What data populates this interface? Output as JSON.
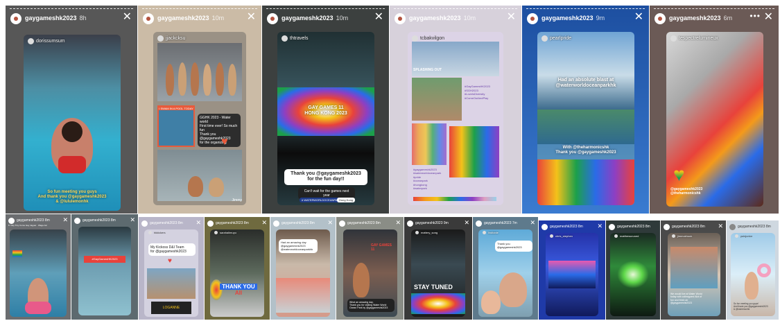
{
  "stories_top": [
    {
      "user": "gaygameshk2023",
      "time": "8h",
      "colors": {
        "bg": "#5b5b5b",
        "accent": "#33b8d4"
      },
      "inner_user": "dorissumsum",
      "caption": [
        "So fun meeting you guys",
        "And thank you @gaygameshk2023",
        "& @lululemonhk"
      ]
    },
    {
      "user": "gaygameshk2023",
      "time": "10m",
      "colors": {
        "bg": "#c9b8a2",
        "accent": "#e85a3b"
      },
      "inner_user": "jjackcksu",
      "sign_text": "I SWAM IN A POOL TODAY",
      "note": [
        "GGHK 2023 - Water world",
        "First time ever! So much fun",
        "Thank you @gaygameshk2023",
        "for the organizing"
      ],
      "footer": "Jimmy"
    },
    {
      "user": "gaygameshk2023",
      "time": "10m",
      "colors": {
        "bg": "#3a3d3c",
        "accent": "#e8423b"
      },
      "inner_user": "thtravels",
      "banner": [
        "GAY GAMES 11",
        "HONG KONG 2023"
      ],
      "caption": [
        "Thank you @gaygameshk2023",
        "for the fun day!!"
      ],
      "sub": [
        "Can't wait for the games next",
        "year"
      ],
      "tags": [
        "# WATERWORLDOCEANPARK",
        "Hong Kong"
      ]
    },
    {
      "user": "gaygameshk2023",
      "time": "10m",
      "colors": {
        "bg": "#d8d2dc",
        "accent": "#8a6fc2"
      },
      "inner_user": "tcbakvilgon",
      "header": "SPLASHING OUT",
      "hashtags": [
        "#GayGamesHK2023",
        "#SGH2023",
        "#LoveIsDiversity",
        "#ComeOutAndPlay"
      ],
      "hashtags2": [
        "#gaygameshk2023",
        "#waterworldoceanpark",
        "#pride",
        "#oceanpark",
        "#hongkong",
        "#waterpark"
      ]
    },
    {
      "user": "gaygameshk2023",
      "time": "9m",
      "colors": {
        "bg": "#2f5fa8",
        "accent": "#f4c21a"
      },
      "inner_user": "pearlpride",
      "caption": [
        "Had an absolute blast at",
        "@waterworldoceanparkhk"
      ],
      "caption2": [
        "With @theharmonicshk",
        "Thank you @gaygameshk2023"
      ]
    },
    {
      "user": "gaygameshk2023",
      "time": "6m",
      "colors": {
        "bg": "#6d5a56",
        "accent": "#e84a3a"
      },
      "inner_user": "tespectrelumineux",
      "caption": [
        "@gaygameshk2023",
        "@theharmonicshk"
      ]
    }
  ],
  "stories_bottom": [
    {
      "user": "gaygameshk2023",
      "time": "8m",
      "sub": "8. Gay Tiny Come Gay Jaguar · Waga Jal"
    },
    {
      "user": "gaygameshk2023",
      "time": "8m",
      "banner": "#GayGamesHK2023"
    },
    {
      "user": "gaygameshk2023",
      "time": "8m",
      "inner": "hkkickers",
      "note": [
        "My Kickoss D&I Team",
        "for @gaygameshk2023"
      ],
      "sign": "LOGANNE"
    },
    {
      "user": "gaygameshk2023",
      "time": "8m",
      "inner": "sarahalimuyu",
      "banner": [
        "THANK YOU",
        "All"
      ]
    },
    {
      "user": "gaygameshk2023",
      "time": "8m",
      "note": [
        "Had an amazing day",
        "@gaygameshk2023",
        "@waterworldoceanparkhk"
      ]
    },
    {
      "user": "gaygameshk2023",
      "time": "8m",
      "banner": "GAY GAMES 11",
      "note": [
        "What an amazing day.",
        "Thank you for visiting Water World",
        "Ocean Park by @gaygameshk2023"
      ]
    },
    {
      "user": "gaygameshk2023",
      "time": "9m",
      "inner": "mattery_song",
      "banner": "STAY TUNED"
    },
    {
      "user": "gaygameshk2023",
      "time": "7m",
      "inner": "lindtanle",
      "note": [
        "Thank you",
        "@gaygameshk2023"
      ]
    },
    {
      "user": "gaygameshk2023",
      "time": "8m",
      "inner": "chris_stephen"
    },
    {
      "user": "gaygameshk2023",
      "time": "8m",
      "inner": "matthewcruned"
    },
    {
      "user": "gaygameshk2023",
      "time": "8m",
      "inner": "jimmukhouk",
      "note": [
        "We would live at Water World",
        "today with colleagues! Alot of",
        "fun and fresh air",
        "@gaygameshk2023"
      ]
    },
    {
      "user": "gaygameshk2023",
      "time": "8m",
      "inner": "yuinjunior",
      "note": [
        "So fun meeting you guys!",
        "And thank you @gaygameshk2023",
        "& @lululemonhk"
      ]
    }
  ]
}
